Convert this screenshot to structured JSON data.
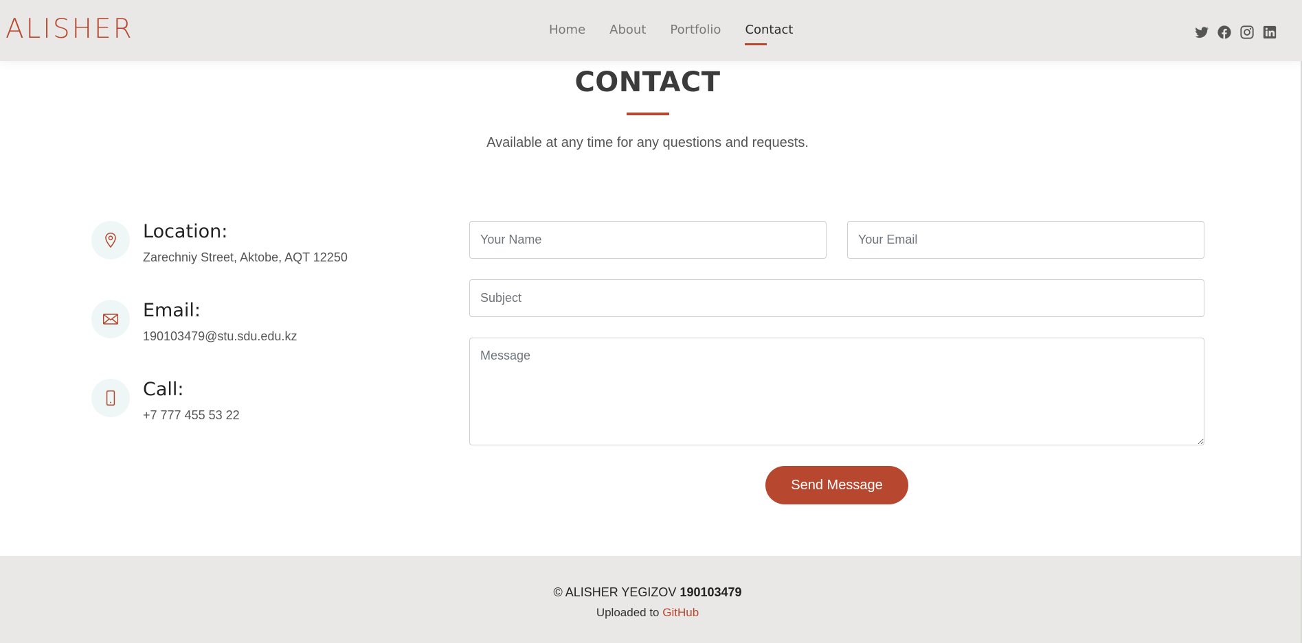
{
  "header": {
    "logo": "ALISHER",
    "nav": [
      {
        "label": "Home",
        "active": false
      },
      {
        "label": "About",
        "active": false
      },
      {
        "label": "Portfolio",
        "active": false
      },
      {
        "label": "Contact",
        "active": true
      }
    ],
    "socials": [
      "twitter-icon",
      "facebook-icon",
      "instagram-icon",
      "linkedin-icon"
    ]
  },
  "section": {
    "title": "CONTACT",
    "subtitle": "Available at any time for any questions and requests."
  },
  "info": [
    {
      "icon": "location-pin-icon",
      "heading": "Location:",
      "text": "Zarechniy Street, Aktobe, AQT 12250"
    },
    {
      "icon": "envelope-icon",
      "heading": "Email:",
      "text": "190103479@stu.sdu.edu.kz"
    },
    {
      "icon": "phone-icon",
      "heading": "Call:",
      "text": "+7 777 455 53 22"
    }
  ],
  "form": {
    "name_placeholder": "Your Name",
    "email_placeholder": "Your Email",
    "subject_placeholder": "Subject",
    "message_placeholder": "Message",
    "submit_label": "Send Message"
  },
  "footer": {
    "copyright_prefix": "© ALISHER YEGIZOV ",
    "copyright_id": "190103479",
    "uploaded_prefix": "Uploaded to ",
    "uploaded_link": "GitHub"
  },
  "colors": {
    "accent": "#b7472e",
    "header_bg": "#e9e8e6",
    "icon_bg": "#eef7f5"
  }
}
